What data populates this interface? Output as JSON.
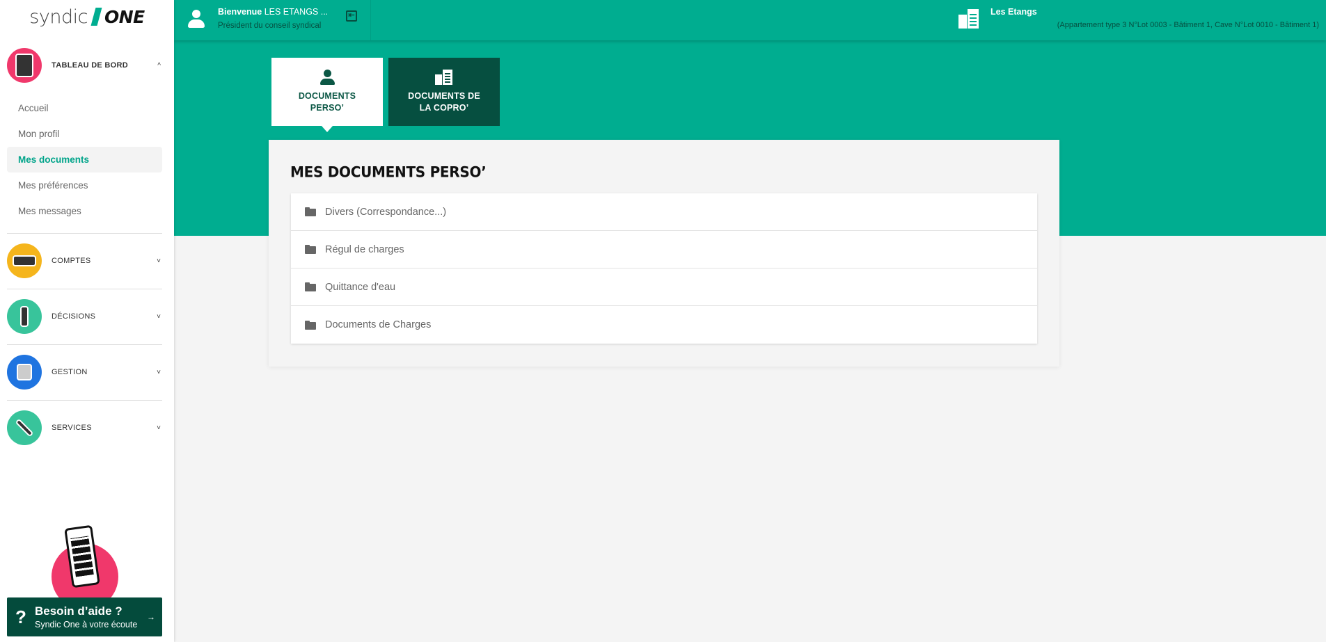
{
  "logo": {
    "part1": "syndic",
    "part2": "ONE"
  },
  "topbar": {
    "welcome_bold": "Bienvenue",
    "welcome_name": " LES ETANGS ...",
    "role": "Président du conseil syndical",
    "copro_name": "Les Etangs",
    "copro_lots": "(Appartement type 3 N°Lot 0003 - Bâtiment 1, Cave N°Lot 0010 - Bâtiment 1)"
  },
  "sidebar": {
    "sections": [
      {
        "label": "TABLEAU DE BORD",
        "chevron": "^",
        "color": "#f0386b"
      },
      {
        "label": "COMPTES",
        "chevron": "˅",
        "color": "#f5b51c"
      },
      {
        "label": "DÉCISIONS",
        "chevron": "˅",
        "color": "#38c49b"
      },
      {
        "label": "GESTION",
        "chevron": "˅",
        "color": "#1f74e0"
      },
      {
        "label": "SERVICES",
        "chevron": "˅",
        "color": "#38c49b"
      }
    ],
    "subitems": [
      {
        "label": "Accueil"
      },
      {
        "label": "Mon profil"
      },
      {
        "label": "Mes documents",
        "active": true
      },
      {
        "label": "Mes préférences"
      },
      {
        "label": "Mes messages"
      }
    ],
    "help": {
      "q": "?",
      "title": "Besoin d’aide ?",
      "subtitle": "Syndic One à votre écoute",
      "arrow": "→"
    }
  },
  "tabs": [
    {
      "label": "DOCUMENTS\nPERSO’",
      "icon": "person-icon",
      "active": true
    },
    {
      "label": "DOCUMENTS DE\nLA COPRO’",
      "icon": "building-icon",
      "active": false
    }
  ],
  "main": {
    "title": "MES DOCUMENTS PERSO’",
    "folders": [
      {
        "name": "Divers (Correspondance...)"
      },
      {
        "name": "Régul de charges"
      },
      {
        "name": "Quittance d'eau"
      },
      {
        "name": "Documents de Charges"
      }
    ]
  },
  "colors": {
    "accent": "#00ad90",
    "dark": "#064f40",
    "pink": "#f0386b"
  }
}
